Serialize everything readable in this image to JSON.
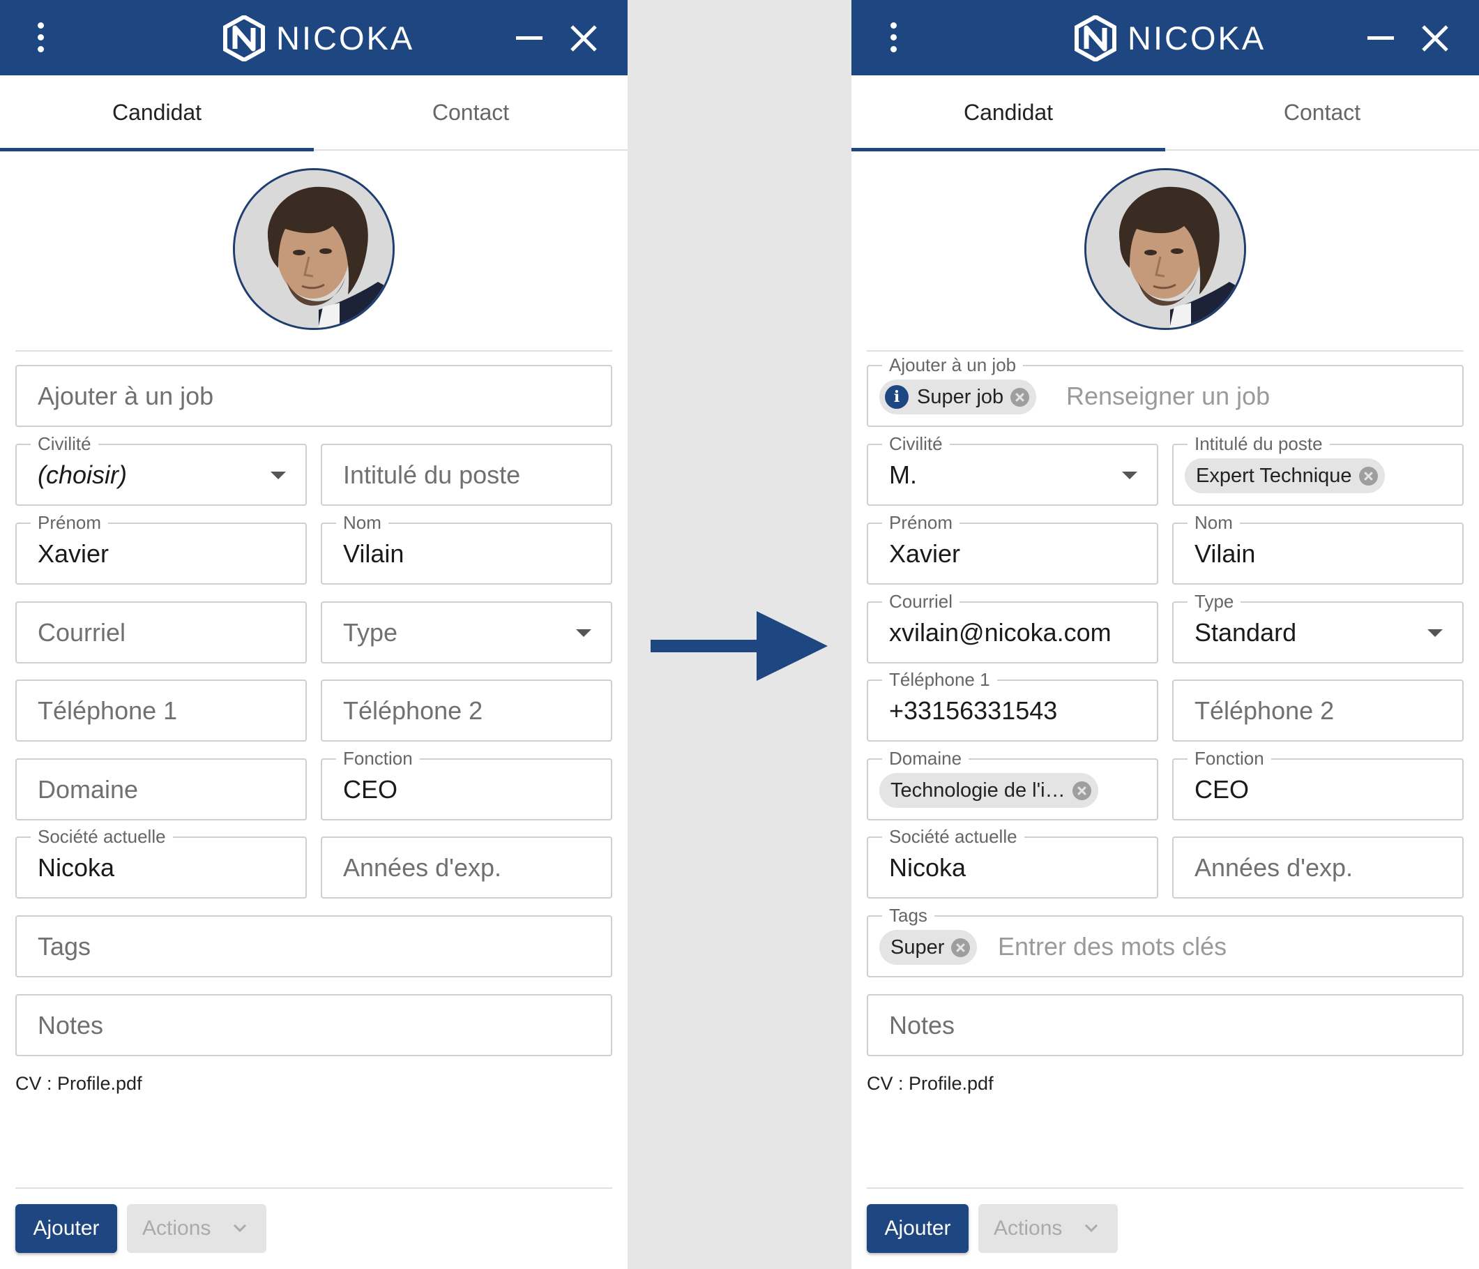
{
  "colors": {
    "brand": "#1e4680",
    "chip": "#e4e4e4",
    "background": "#e6e6e6"
  },
  "header": {
    "logo_text": "NICOKA",
    "menu_icon": "more-vert-icon",
    "min_icon": "minimize-icon",
    "close_icon": "close-icon"
  },
  "tabs": [
    {
      "label": "Candidat",
      "active": true
    },
    {
      "label": "Contact",
      "active": false
    }
  ],
  "left": {
    "job": {
      "placeholder": "Ajouter à un job"
    },
    "civilite": {
      "label": "Civilité",
      "value": "(choisir)"
    },
    "intitule": {
      "placeholder": "Intitulé du poste"
    },
    "prenom": {
      "label": "Prénom",
      "value": "Xavier"
    },
    "nom": {
      "label": "Nom",
      "value": "Vilain"
    },
    "courriel": {
      "placeholder": "Courriel"
    },
    "type": {
      "placeholder": "Type"
    },
    "tel1": {
      "placeholder": "Téléphone 1"
    },
    "tel2": {
      "placeholder": "Téléphone 2"
    },
    "domaine": {
      "placeholder": "Domaine"
    },
    "fonction": {
      "label": "Fonction",
      "value": "CEO"
    },
    "societe": {
      "label": "Société actuelle",
      "value": "Nicoka"
    },
    "annees": {
      "placeholder": "Années d'exp."
    },
    "tags": {
      "placeholder": "Tags"
    },
    "notes": {
      "placeholder": "Notes"
    },
    "cv": "CV : Profile.pdf",
    "add_button": "Ajouter",
    "actions_button": "Actions"
  },
  "right": {
    "job": {
      "label": "Ajouter à un job",
      "chip": "Super job",
      "placeholder": "Renseigner un job"
    },
    "civilite": {
      "label": "Civilité",
      "value": "M."
    },
    "intitule": {
      "label": "Intitulé du poste",
      "chip": "Expert Technique"
    },
    "prenom": {
      "label": "Prénom",
      "value": "Xavier"
    },
    "nom": {
      "label": "Nom",
      "value": "Vilain"
    },
    "courriel": {
      "label": "Courriel",
      "value": "xvilain@nicoka.com"
    },
    "type": {
      "label": "Type",
      "value": "Standard"
    },
    "tel1": {
      "label": "Téléphone 1",
      "value": "+33156331543"
    },
    "tel2": {
      "placeholder": "Téléphone 2"
    },
    "domaine": {
      "label": "Domaine",
      "chip": "Technologie de l'i…"
    },
    "fonction": {
      "label": "Fonction",
      "value": "CEO"
    },
    "societe": {
      "label": "Société actuelle",
      "value": "Nicoka"
    },
    "annees": {
      "placeholder": "Années d'exp."
    },
    "tags": {
      "label": "Tags",
      "chip": "Super",
      "placeholder": "Entrer des mots clés"
    },
    "notes": {
      "placeholder": "Notes"
    },
    "cv": "CV : Profile.pdf",
    "add_button": "Ajouter",
    "actions_button": "Actions"
  }
}
